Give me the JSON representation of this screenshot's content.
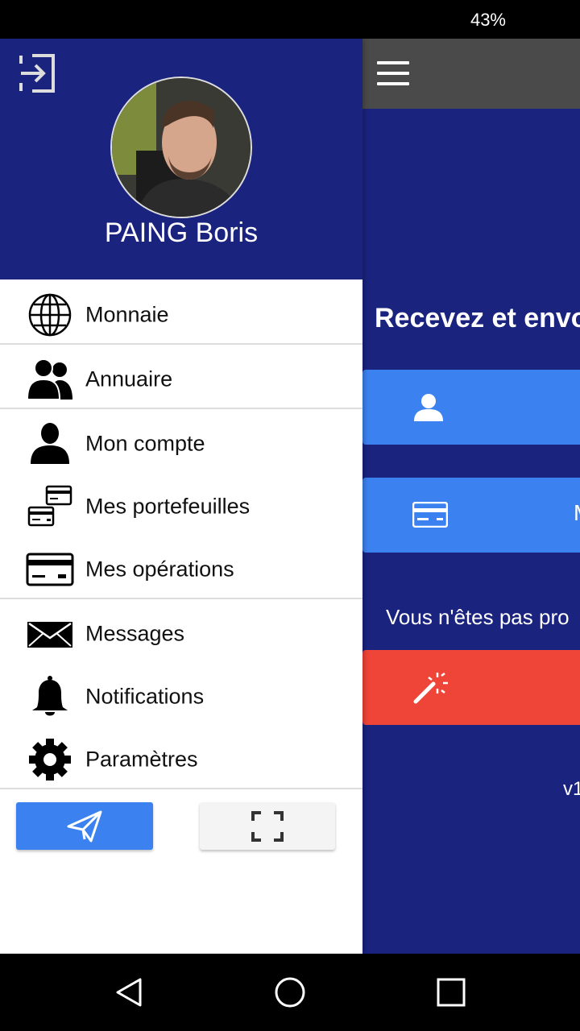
{
  "status_bar": {
    "battery": "43%"
  },
  "drawer": {
    "user_name": "PAING Boris",
    "menu": [
      {
        "label": "Monnaie",
        "icon": "globe-icon"
      },
      {
        "label": "Annuaire",
        "icon": "users-icon"
      },
      {
        "label": "Mon compte",
        "icon": "user-icon"
      },
      {
        "label": "Mes portefeuilles",
        "icon": "wallets-icon"
      },
      {
        "label": "Mes opérations",
        "icon": "credit-card-icon"
      },
      {
        "label": "Messages",
        "icon": "envelope-icon"
      },
      {
        "label": "Notifications",
        "icon": "bell-icon"
      },
      {
        "label": "Paramètres",
        "icon": "gear-icon"
      }
    ],
    "bottom_buttons": [
      {
        "icon": "send-icon"
      },
      {
        "icon": "scan-icon"
      }
    ]
  },
  "app": {
    "headline": "Recevez et envo",
    "button2_label": "M",
    "not_pro_text": "Vous n'êtes pas pro",
    "version": "v1"
  },
  "colors": {
    "primary": "#1a237e",
    "accent_blue": "#3b82f0",
    "accent_red": "#ef4538",
    "toolbar_gray": "#4a4a4a"
  }
}
